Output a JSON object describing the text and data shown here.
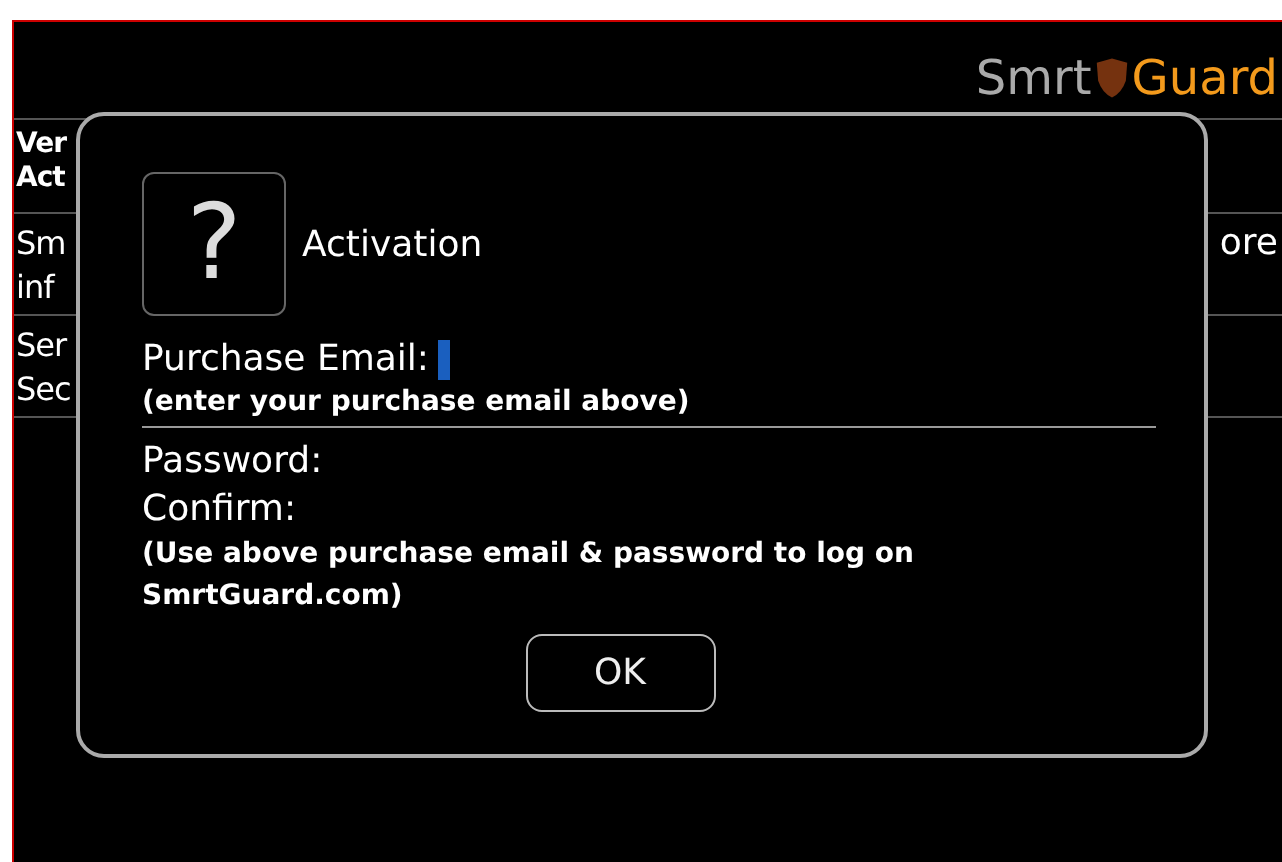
{
  "header": {
    "logo": {
      "part_1": "Smrt",
      "part_2": "Guard"
    }
  },
  "background_rows": [
    {
      "lines": [
        "Ver",
        "Act"
      ],
      "bold": true,
      "right": ""
    },
    {
      "lines": [
        "Sm",
        "inf"
      ],
      "bold": false,
      "right": "ore"
    },
    {
      "lines": [
        "Ser",
        "Sec"
      ],
      "bold": false,
      "right": ""
    }
  ],
  "dialog": {
    "icon": "?",
    "title": "Activation",
    "email_label": "Purchase Email:",
    "email_hint": "(enter your purchase email above)",
    "password_label": "Password:",
    "confirm_label": "Confirm:",
    "note": "(Use above purchase email & password to log on SmrtGuard.com)",
    "buttons": [
      "OK"
    ]
  }
}
